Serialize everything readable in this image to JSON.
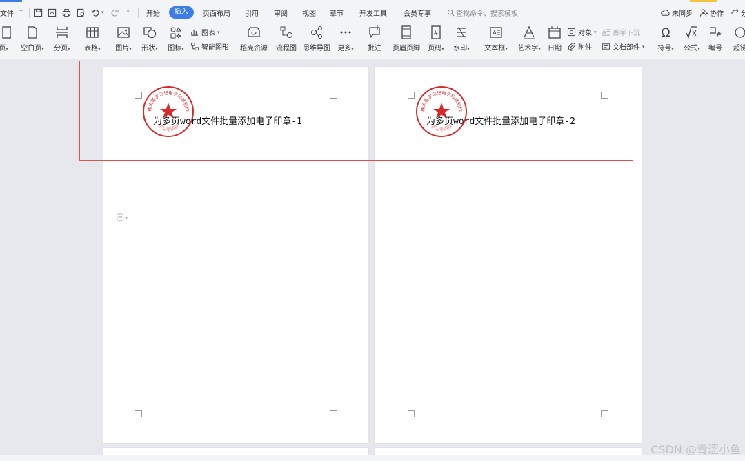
{
  "menu": {
    "file": "文件",
    "tabs": [
      "开始",
      "插入",
      "页面布局",
      "引用",
      "审阅",
      "视图",
      "章节",
      "开发工具",
      "会员专享"
    ],
    "active_tab": "插入",
    "search_placeholder": "查找命令、搜索模板",
    "sync": "未同步",
    "collab": "协作",
    "share": "分"
  },
  "ribbon": {
    "page": "页",
    "blank_page": "空白页",
    "page_break": "分页",
    "table": "表格",
    "picture": "图片",
    "shape": "形状",
    "icon": "图标",
    "chart": "图表",
    "smart_art": "智能图形",
    "daoke": "稻壳资源",
    "flowchart": "流程图",
    "mindmap": "思维导图",
    "more": "更多",
    "comment": "批注",
    "header_footer": "页眉页脚",
    "page_number": "页码",
    "watermark": "水印",
    "textbox": "文本框",
    "word_art": "艺术字",
    "date": "日期",
    "object": "对象",
    "attachment": "附件",
    "drop_cap": "首字下沉",
    "doc_parts": "文档部件",
    "symbol": "符号",
    "formula": "公式",
    "numbering": "编号",
    "hyperlink": "超链"
  },
  "document": {
    "page1_text": "为多页word文件批量添加电子印章-1",
    "page2_text": "为多页word文件批量添加电子印章-2",
    "seal_text": "株大哥学习记电子印章制作",
    "seal_bottom_text": "学习专用章"
  },
  "colors": {
    "accent": "#3d7de8",
    "seal_red": "#d42a2a",
    "highlight": "#d9534f"
  },
  "watermark": "CSDN @青涩小鱼"
}
